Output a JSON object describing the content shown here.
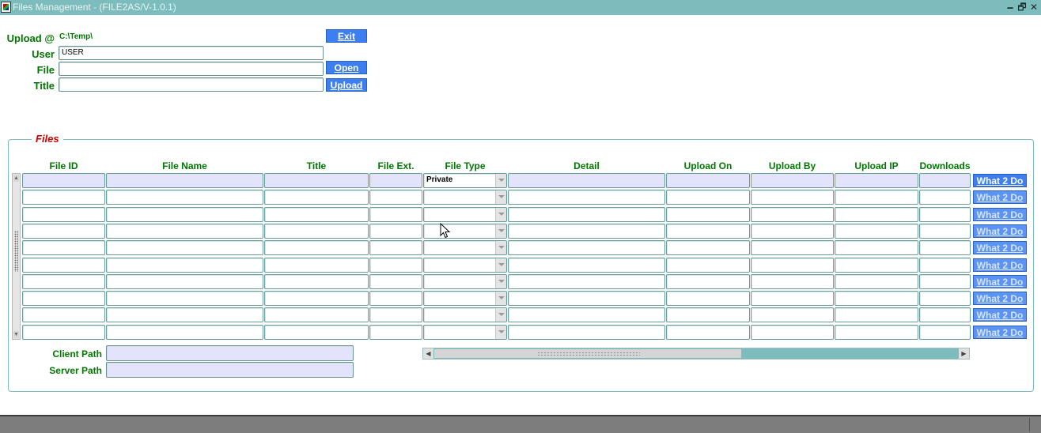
{
  "window": {
    "title": "Files Management - (FILE2AS/V-1.0.1)",
    "minimize_glyph": "🗕",
    "restore_glyph": "🗗",
    "close_glyph": "✕"
  },
  "form": {
    "upload_label": "Upload @",
    "upload_path": "C:\\Temp\\",
    "user_label": "User",
    "user_value": "USER",
    "file_label": "File",
    "file_value": "",
    "title_label": "Title",
    "title_value": ""
  },
  "buttons": {
    "exit": "Exit",
    "open": "Open",
    "upload": "Upload"
  },
  "files": {
    "group_title": "Files",
    "columns": [
      "File ID",
      "File Name",
      "Title",
      "File Ext.",
      "File Type",
      "Detail",
      "Upload On",
      "Upload By",
      "Upload IP",
      "Downloads"
    ],
    "rows": [
      {
        "file_type": "Private"
      },
      {
        "file_type": ""
      },
      {
        "file_type": ""
      },
      {
        "file_type": ""
      },
      {
        "file_type": ""
      },
      {
        "file_type": ""
      },
      {
        "file_type": ""
      },
      {
        "file_type": ""
      },
      {
        "file_type": ""
      },
      {
        "file_type": ""
      }
    ],
    "row_action_label": "What 2 Do",
    "client_path_label": "Client Path",
    "client_path_value": "",
    "server_path_label": "Server Path",
    "server_path_value": ""
  },
  "colors": {
    "title_bar": "#7dbcbc",
    "label_green": "#007700",
    "group_title_red": "#cc0000",
    "button_blue": "#3d7ff0",
    "current_row": "#e3e3fb"
  },
  "icons": {
    "app": "app-icon",
    "cursor": "mouse-pointer-icon"
  }
}
